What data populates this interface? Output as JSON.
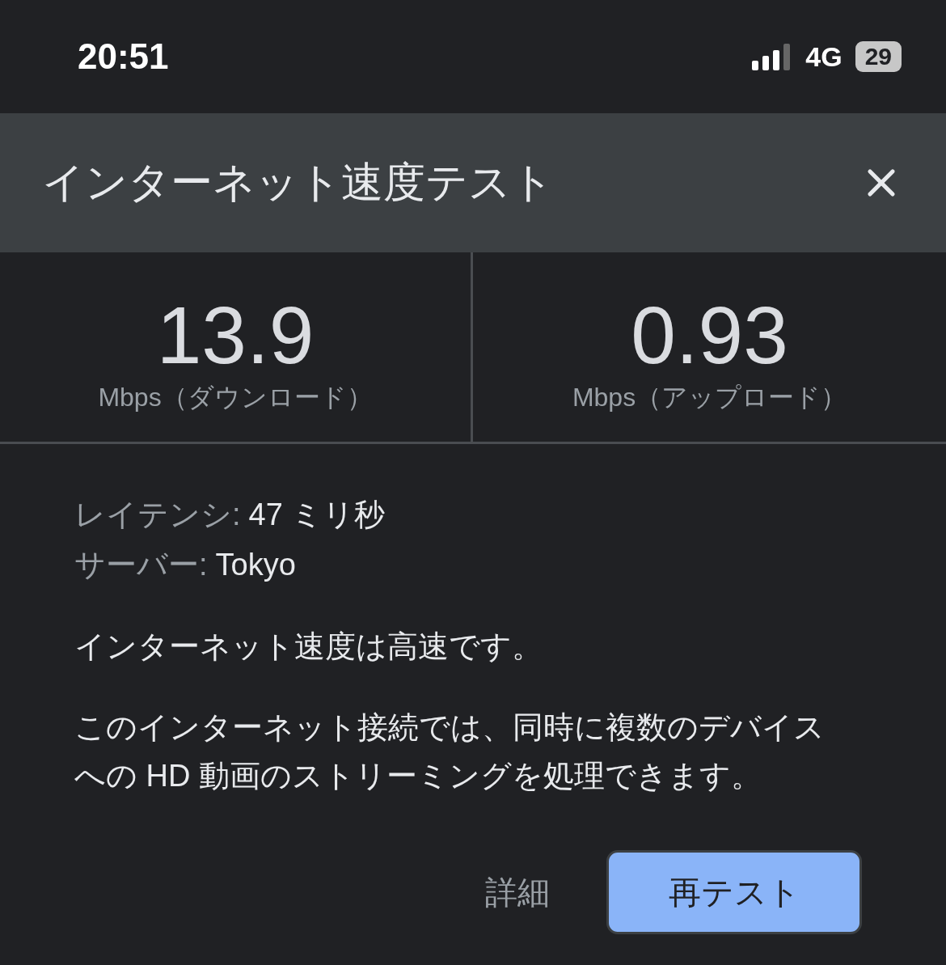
{
  "status_bar": {
    "time": "20:51",
    "network": "4G",
    "battery": "29"
  },
  "dialog": {
    "title": "インターネット速度テスト"
  },
  "results": [
    {
      "value": "13.9",
      "unit": "Mbps（ダウンロード）"
    },
    {
      "value": "0.93",
      "unit": "Mbps（アップロード）"
    }
  ],
  "details": [
    {
      "label": "レイテンシ:",
      "value": "47 ミリ秒"
    },
    {
      "label": "サーバー:",
      "value": "Tokyo"
    }
  ],
  "summary": "インターネット速度は高速です。",
  "description": "このインターネット接続では、同時に複数のデバイスへの HD 動画のストリーミングを処理できます。",
  "buttons": [
    {
      "label": "詳細",
      "kind": "text"
    },
    {
      "label": "再テスト",
      "kind": "filled"
    }
  ]
}
